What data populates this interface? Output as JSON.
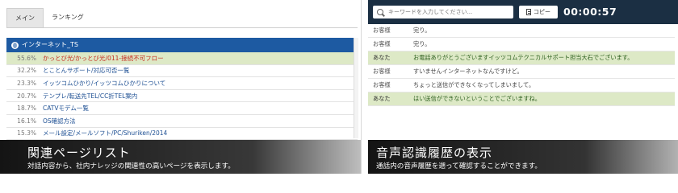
{
  "left": {
    "tabs": [
      {
        "label": "メイン",
        "active": true
      },
      {
        "label": "ランキング",
        "active": false
      }
    ],
    "section_title": "インターネット_TS",
    "rows": [
      {
        "pct": "55.6%",
        "title": "かっとび光/かっとび光/011-接続不可フロー",
        "highlight": true
      },
      {
        "pct": "32.2%",
        "title": "とことんサポート/対応可否一覧",
        "highlight": false
      },
      {
        "pct": "23.3%",
        "title": "イッツコムひかり/イッツコムひかりについて",
        "highlight": false
      },
      {
        "pct": "20.7%",
        "title": "テンプレ/転送先TEL/CC折TEL案内",
        "highlight": false
      },
      {
        "pct": "18.7%",
        "title": "CATVモデム一覧",
        "highlight": false
      },
      {
        "pct": "16.1%",
        "title": "OS確認方法",
        "highlight": false
      },
      {
        "pct": "15.3%",
        "title": "メール設定/メールソフト/PC/Shuriken/2014",
        "highlight": false
      }
    ],
    "caption": {
      "title": "関連ページリスト",
      "description": "対話内容から、社内ナレッジの関連性の高いページを表示します。"
    }
  },
  "right": {
    "search_placeholder": "キーワードを入力してください...",
    "copy_label": "コピー",
    "timer": "00:00:57",
    "messages": [
      {
        "speaker": "お客様",
        "text": "完り。",
        "agent": false
      },
      {
        "speaker": "お客様",
        "text": "完り。",
        "agent": false
      },
      {
        "speaker": "あなた",
        "text": "お電話ありがとうございますイッツコムテクニカルサポート担当大石でございます。",
        "agent": true
      },
      {
        "speaker": "お客様",
        "text": "すいませんインターネットなんですけど。",
        "agent": false
      },
      {
        "speaker": "お客様",
        "text": "ちょっと送信ができなくなってしまいまして。",
        "agent": false
      },
      {
        "speaker": "あなた",
        "text": "はい送信ができないということでございますね。",
        "agent": true
      }
    ],
    "caption": {
      "title": "音声認識履歴の表示",
      "description": "通話内の音声履歴を遡って確認することができます。"
    }
  },
  "colors": {
    "section_header": "#1d5aa2",
    "highlight_row": "#dde9c6",
    "highlight_text": "#c62a1e",
    "link_text": "#1d4f93",
    "topbar": "#1b2f43"
  }
}
